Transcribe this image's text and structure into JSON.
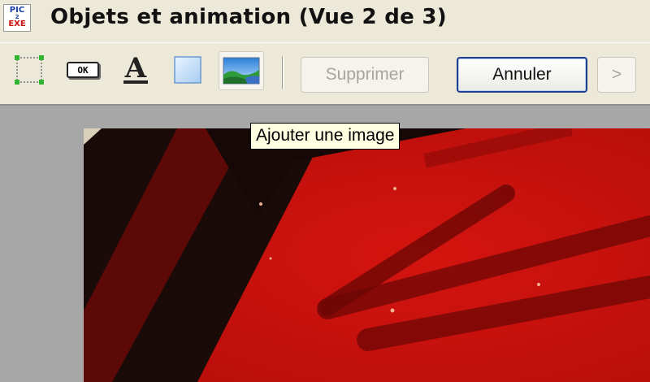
{
  "window": {
    "title": "Objets et animation  (Vue 2 de 3)",
    "logo": {
      "line1": "PIC",
      "line2": "2",
      "line3": "EXE"
    }
  },
  "toolbar": {
    "tools": [
      {
        "name": "select-rectangle-tool",
        "icon": "dashed-rectangle-icon"
      },
      {
        "name": "add-button-tool",
        "icon": "button-ok-icon",
        "label": "OK"
      },
      {
        "name": "add-text-tool",
        "icon": "text-a-icon",
        "label": "A"
      },
      {
        "name": "add-rectangle-tool",
        "icon": "blue-rectangle-icon"
      },
      {
        "name": "add-image-tool",
        "icon": "landscape-image-icon",
        "state": "hover"
      }
    ],
    "delete_label": "Supprimer",
    "cancel_label": "Annuler",
    "next_label": ">"
  },
  "tooltip": {
    "text": "Ajouter une image"
  },
  "colors": {
    "chrome": "#ece9d8",
    "workspace": "#a7a7a7",
    "photo_red": "#c8110d",
    "primary_border": "#1f3f8f",
    "tooltip_bg": "#ffffe1"
  }
}
